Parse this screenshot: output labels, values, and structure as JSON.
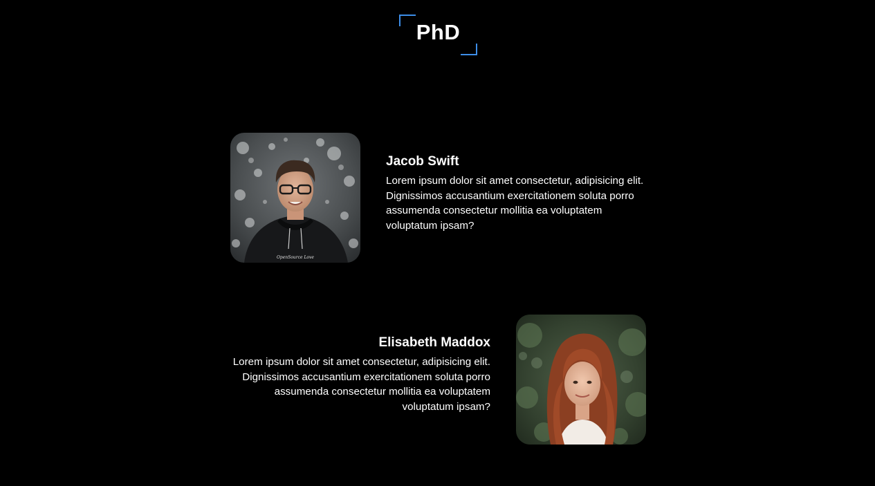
{
  "section": {
    "title": "PhD",
    "accent_color": "#3d8ee8"
  },
  "members": [
    {
      "name": "Jacob Swift",
      "bio": "Lorem ipsum dolor sit amet consectetur, adipisicing elit. Dignissimos accusantium exercitationem soluta porro assumenda consectetur mollitia ea voluptatem voluptatum ipsam?",
      "photo_icon": "man-portrait-photo",
      "sweater_text": "OpenSource Love"
    },
    {
      "name": "Elisabeth Maddox",
      "bio": "Lorem ipsum dolor sit amet consectetur, adipisicing elit. Dignissimos accusantium exercitationem soluta porro assumenda consectetur mollitia ea voluptatem voluptatum ipsam?",
      "photo_icon": "woman-portrait-photo"
    }
  ]
}
